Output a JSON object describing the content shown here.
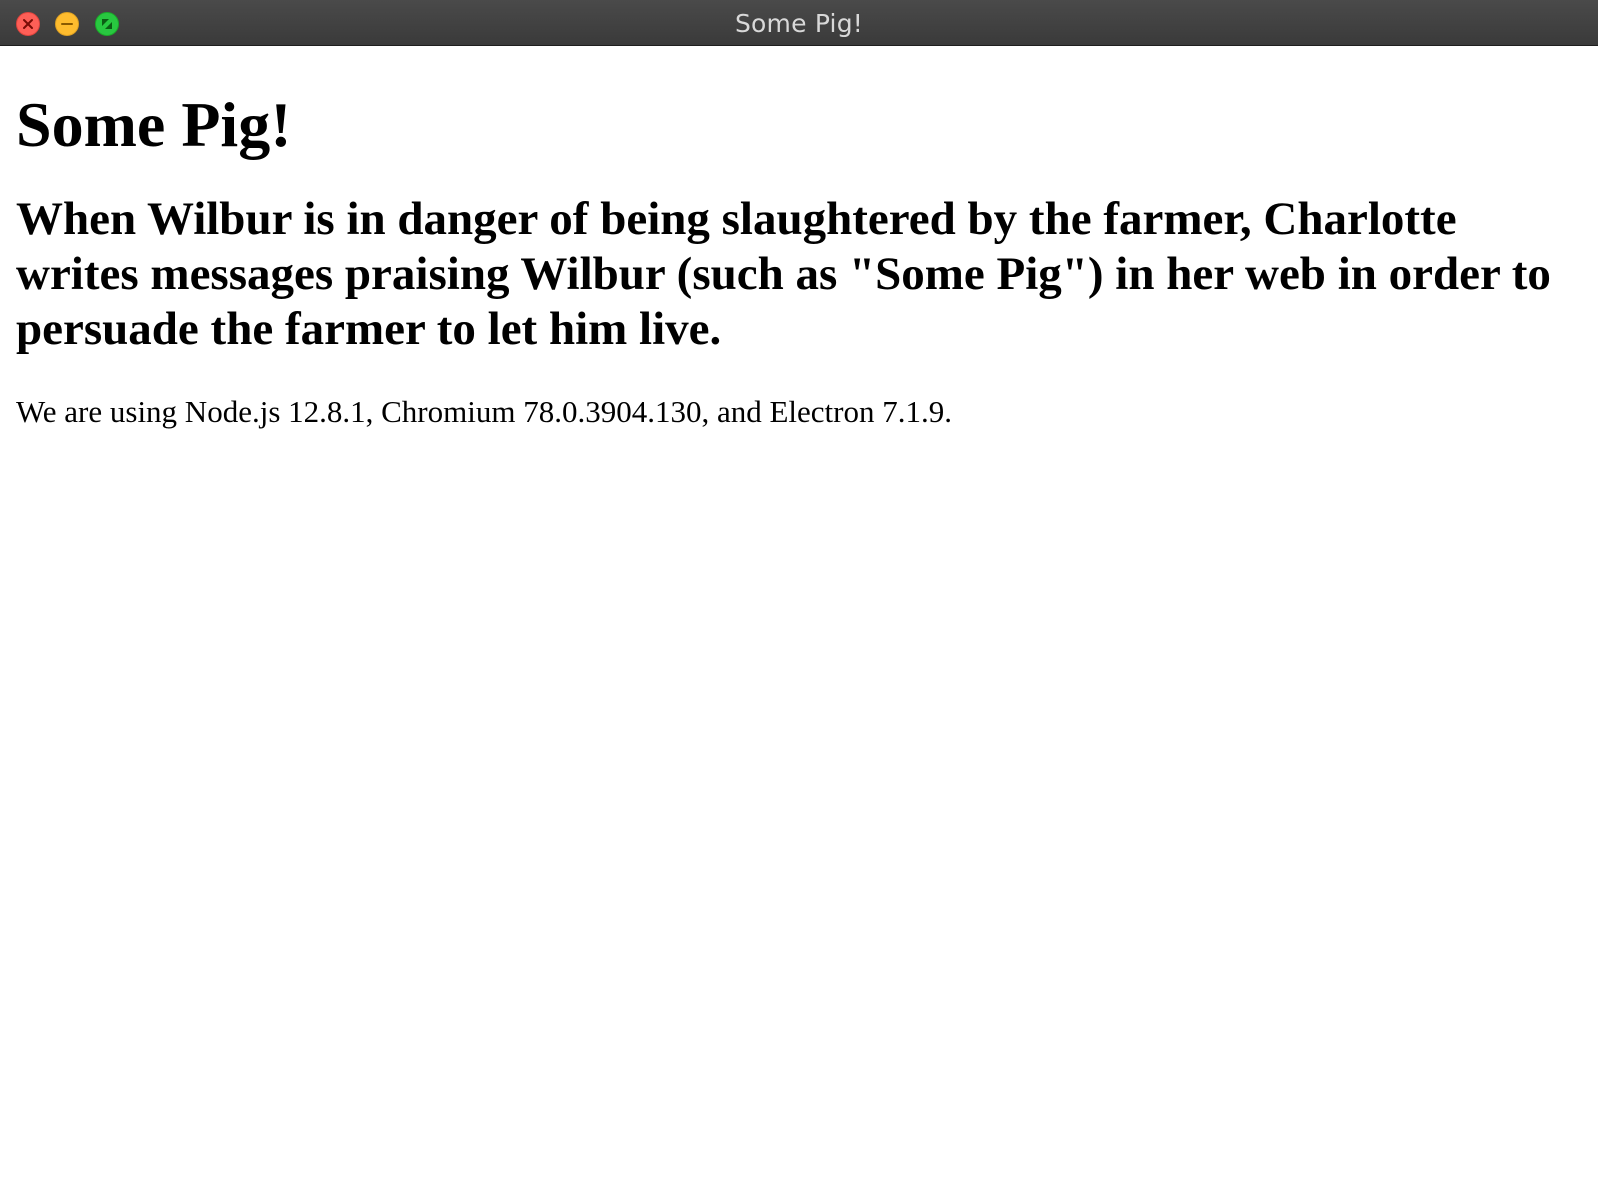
{
  "window": {
    "title": "Some Pig!"
  },
  "content": {
    "heading": "Some Pig!",
    "subheading": "When Wilbur is in danger of being slaughtered by the farmer, Charlotte writes messages praising Wilbur (such as \"Some Pig\") in her web in order to persuade the farmer to let him live.",
    "versions_text": "We are using Node.js 12.8.1, Chromium 78.0.3904.130, and Electron 7.1.9."
  },
  "icons": {
    "close": "close-icon",
    "minimize": "minimize-icon",
    "fullscreen": "fullscreen-icon"
  },
  "colors": {
    "titlebar": "#3f3f3f",
    "title_text": "#d8d8d8",
    "close": "#fe5f57",
    "minimize": "#febc2e",
    "fullscreen": "#28c840",
    "page_background": "#ffffff",
    "text": "#000000"
  }
}
